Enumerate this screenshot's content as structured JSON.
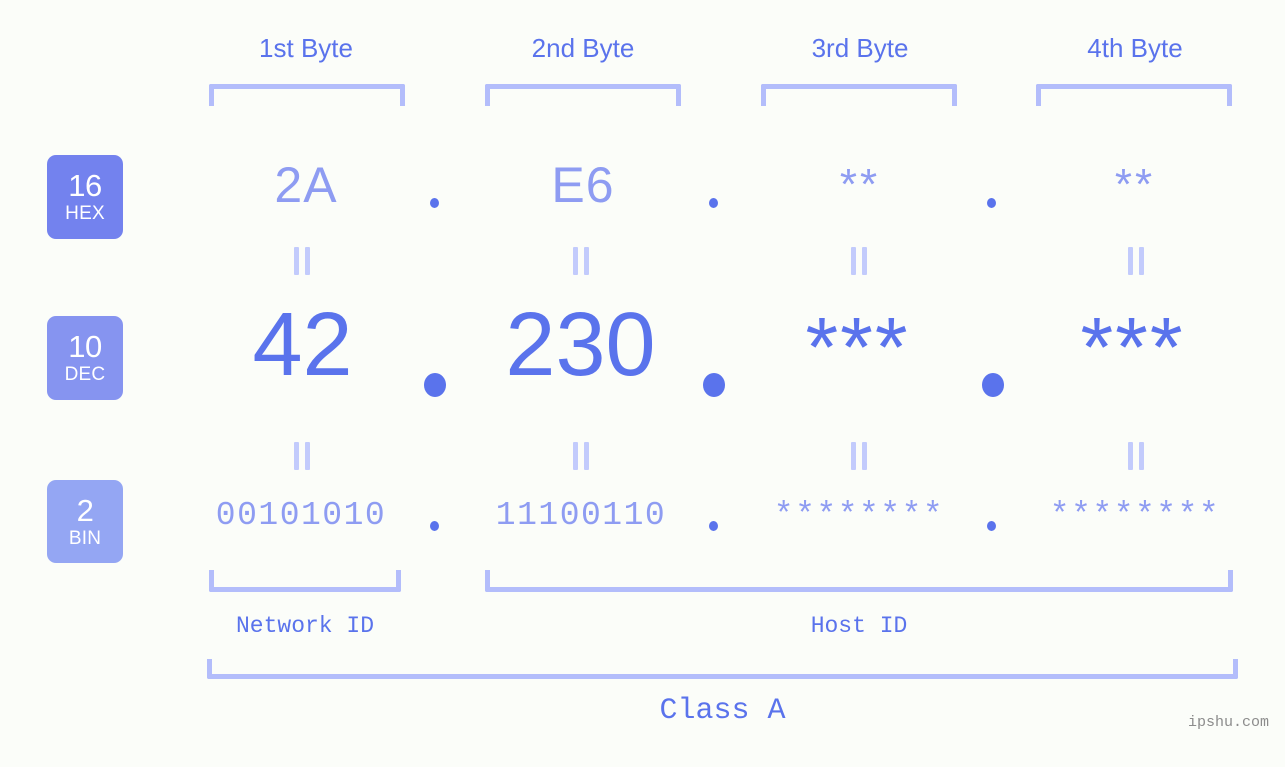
{
  "header": {
    "byte_labels": [
      "1st Byte",
      "2nd Byte",
      "3rd Byte",
      "4th Byte"
    ]
  },
  "bases": [
    {
      "number": "16",
      "name": "HEX",
      "color": "#7382ee"
    },
    {
      "number": "10",
      "name": "DEC",
      "color": "#8694f0"
    },
    {
      "number": "2",
      "name": "BIN",
      "color": "#94a6f3"
    }
  ],
  "rows": {
    "hex": {
      "values": [
        "2A",
        "E6",
        "**",
        "**"
      ],
      "separator": "."
    },
    "dec": {
      "values": [
        "42",
        "230",
        "***",
        "***"
      ],
      "separator": "."
    },
    "bin": {
      "values": [
        "00101010",
        "11100110",
        "********",
        "********"
      ],
      "separator": "."
    }
  },
  "equals_marker": "||",
  "footer": {
    "network_id_label": "Network ID",
    "host_id_label": "Host ID",
    "class_label": "Class A"
  },
  "watermark": "ipshu.com",
  "colors": {
    "background": "#fbfdf9",
    "accent": "#5a73ec",
    "accent_light": "#8e9cf2",
    "bracket": "#b3bdfb",
    "eqbar": "#c2cbfc",
    "watermark": "#8c8c8c"
  }
}
